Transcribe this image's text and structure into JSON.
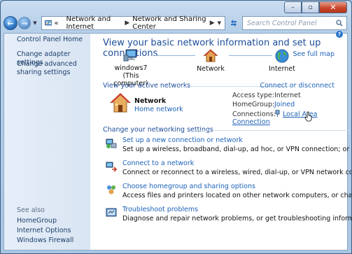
{
  "window": {
    "caption": {
      "minimize": "–",
      "maximize": "▫",
      "close": "✕"
    }
  },
  "nav": {
    "back": "←",
    "forward": "→",
    "breadcrumb": [
      "«",
      "Network and Internet",
      "Network and Sharing Center"
    ],
    "search_placeholder": "Search Control Panel"
  },
  "sidebar": {
    "items": [
      {
        "label": "Control Panel Home"
      },
      {
        "label": "Change adapter settings"
      },
      {
        "label": "Change advanced sharing settings"
      }
    ],
    "see_also_label": "See also",
    "see_also": [
      "HomeGroup",
      "Internet Options",
      "Windows Firewall"
    ]
  },
  "main": {
    "title": "View your basic network information and set up connections",
    "see_full_map": "See full map",
    "map": [
      {
        "label": "windows7",
        "sublabel": "(This computer)",
        "icon": "computer-icon"
      },
      {
        "label": "Network",
        "icon": "house-icon"
      },
      {
        "label": "Internet",
        "icon": "globe-icon"
      }
    ],
    "active_networks_label": "View your active networks",
    "connect_disconnect": "Connect or disconnect",
    "network": {
      "name": "Network",
      "type": "Home network",
      "access_type_label": "Access type:",
      "access_type": "Internet",
      "homegroup_label": "HomeGroup:",
      "homegroup": "Joined",
      "connections_label": "Connections:",
      "connection": "Local Area Connection"
    },
    "settings_label": "Change your networking settings",
    "tasks": [
      {
        "title": "Set up a new connection or network",
        "desc": "Set up a wireless, broadband, dial-up, ad hoc, or VPN connection; or set up a router or access point.",
        "icon": "new-connection-icon"
      },
      {
        "title": "Connect to a network",
        "desc": "Connect or reconnect to a wireless, wired, dial-up, or VPN network connection.",
        "icon": "connect-network-icon"
      },
      {
        "title": "Choose homegroup and sharing options",
        "desc": "Access files and printers located on other network computers, or change sharing settings.",
        "icon": "homegroup-icon"
      },
      {
        "title": "Troubleshoot problems",
        "desc": "Diagnose and repair network problems, or get troubleshooting information.",
        "icon": "troubleshoot-icon"
      }
    ]
  },
  "colors": {
    "link": "#1c62b9",
    "title": "#1c4d99",
    "frame": "#a9c6e4"
  }
}
